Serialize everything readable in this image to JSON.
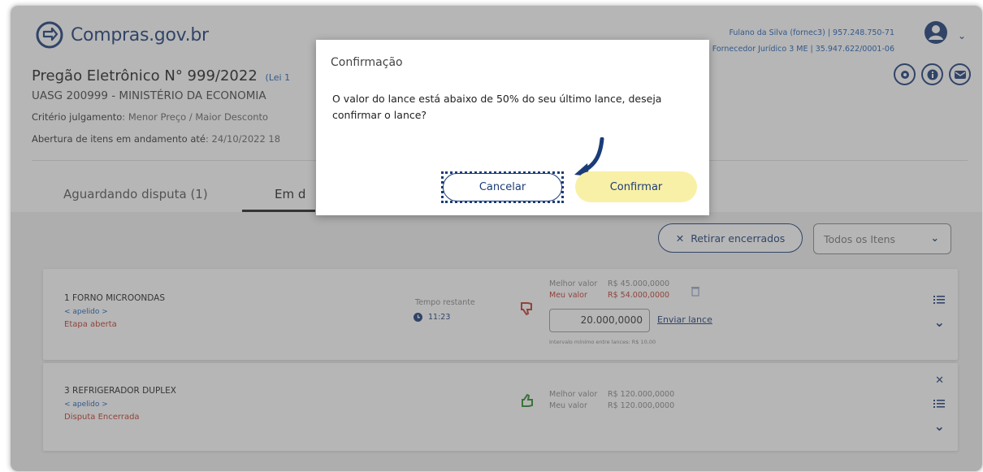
{
  "header": {
    "logo_text": "Compras.gov.br",
    "user_line1": "Fulano da Silva (fornec3) | 957.248.750-71",
    "user_line2": "Fornecedor Jurídico 3 ME | 35.947.622/0001-06",
    "avatar_icon": "user-avatar-icon"
  },
  "pregao": {
    "title": "Pregão Eletrônico N° 999/2022",
    "lei": "(Lei 1",
    "uasg": "UASG 200999 - MINISTÉRIO DA ECONOMIA",
    "criterio_label": "Critério julgamento",
    "criterio_value": ": Menor Preço / Maior Desconto",
    "abertura_label": "Abertura de itens em andamento até",
    "abertura_value": ": 24/10/2022 18"
  },
  "header_icons": [
    "gear-icon",
    "info-icon",
    "mail-icon"
  ],
  "tabs": [
    {
      "label": "Aguardando disputa (1)"
    },
    {
      "label": "Em d"
    }
  ],
  "filters": {
    "retirar_label": "Retirar encerrados",
    "select_value": "Todos os Itens"
  },
  "items": [
    {
      "name": "1  FORNO MICROONDAS",
      "apelido": "< apelido >",
      "etapa": "Etapa aberta",
      "tempo_label": "Tempo restante",
      "tempo_value": "11:23",
      "melhor_label": "Melhor valor",
      "melhor_value": "R$ 45.000,0000",
      "meu_label": "Meu valor",
      "meu_value": "R$ 54.000,0000",
      "lance_value": "20.000,0000",
      "enviar_label": "Enviar lance",
      "intervalo": "Intervalo mínimo entre lances: R$ 10,00"
    },
    {
      "name": "3  REFRIGERADOR DUPLEX",
      "apelido": "< apelido >",
      "etapa": "Disputa Encerrada",
      "melhor_label": "Melhor valor",
      "melhor_value": "R$ 120.000,0000",
      "meu_label": "Meu valor",
      "meu_value": "R$ 120.000,0000"
    }
  ],
  "modal": {
    "title": "Confirmação",
    "message": "O valor do lance está abaixo de 50% do seu último lance, deseja confirmar o lance?",
    "cancel_label": "Cancelar",
    "confirm_label": "Confirmar"
  },
  "colors": {
    "brand": "#1b3c78",
    "confirm_bg": "#f9f0a7",
    "alert_red": "#c0392b",
    "thumb_green": "#2e8b2e"
  }
}
